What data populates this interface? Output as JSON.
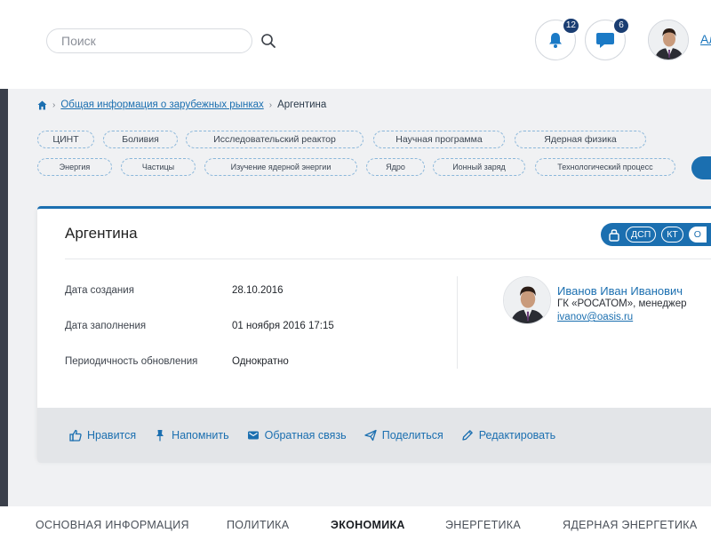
{
  "header": {
    "search_placeholder": "Поиск",
    "notifications_count": "12",
    "messages_count": "6",
    "user_link": "Ал"
  },
  "breadcrumb": {
    "section": "Общая информация о зарубежных рынках",
    "current": "Аргентина"
  },
  "tags_row1": [
    "ЦИНТ",
    "Боливия",
    "Исследовательский реактор",
    "Научная программа",
    "Ядерная физика"
  ],
  "tags_row2": [
    "Энергия",
    "Частицы",
    "Изучение ядерной энергии",
    "Ядро",
    "Ионный заряд",
    "Технологический процесс"
  ],
  "card": {
    "title": "Аргентина",
    "access_labels": [
      "ДСП",
      "КТ",
      "О"
    ],
    "rows": [
      {
        "label": "Дата создания",
        "value": "28.10.2016"
      },
      {
        "label": "Дата заполнения",
        "value": "01 ноября 2016 17:15"
      },
      {
        "label": "Периодичность обновления",
        "value": "Однократно"
      }
    ],
    "owner": {
      "name": "Иванов Иван Иванович",
      "role": "ГК «РОСАТОМ», менеджер",
      "email": "ivanov@oasis.ru"
    },
    "actions": [
      "Нравится",
      "Напомнить",
      "Обратная связь",
      "Поделиться",
      "Редактировать"
    ]
  },
  "tabs": [
    "ОСНОВНАЯ ИНФОРМАЦИЯ",
    "ПОЛИТИКА",
    "ЭКОНОМИКА",
    "ЭНЕРГЕТИКА",
    "ЯДЕРНАЯ ЭНЕРГЕТИКА"
  ],
  "active_tab": "ЭКОНОМИКА",
  "colors": {
    "accent": "#1b6fb0",
    "badge": "#1a3d72",
    "action_bar": "#e3e5e8"
  },
  "icons": [
    "search-icon",
    "bell-icon",
    "chat-icon",
    "home-icon",
    "lock-icon",
    "thumbs-up-icon",
    "pin-icon",
    "message-icon",
    "share-icon",
    "pencil-icon"
  ]
}
